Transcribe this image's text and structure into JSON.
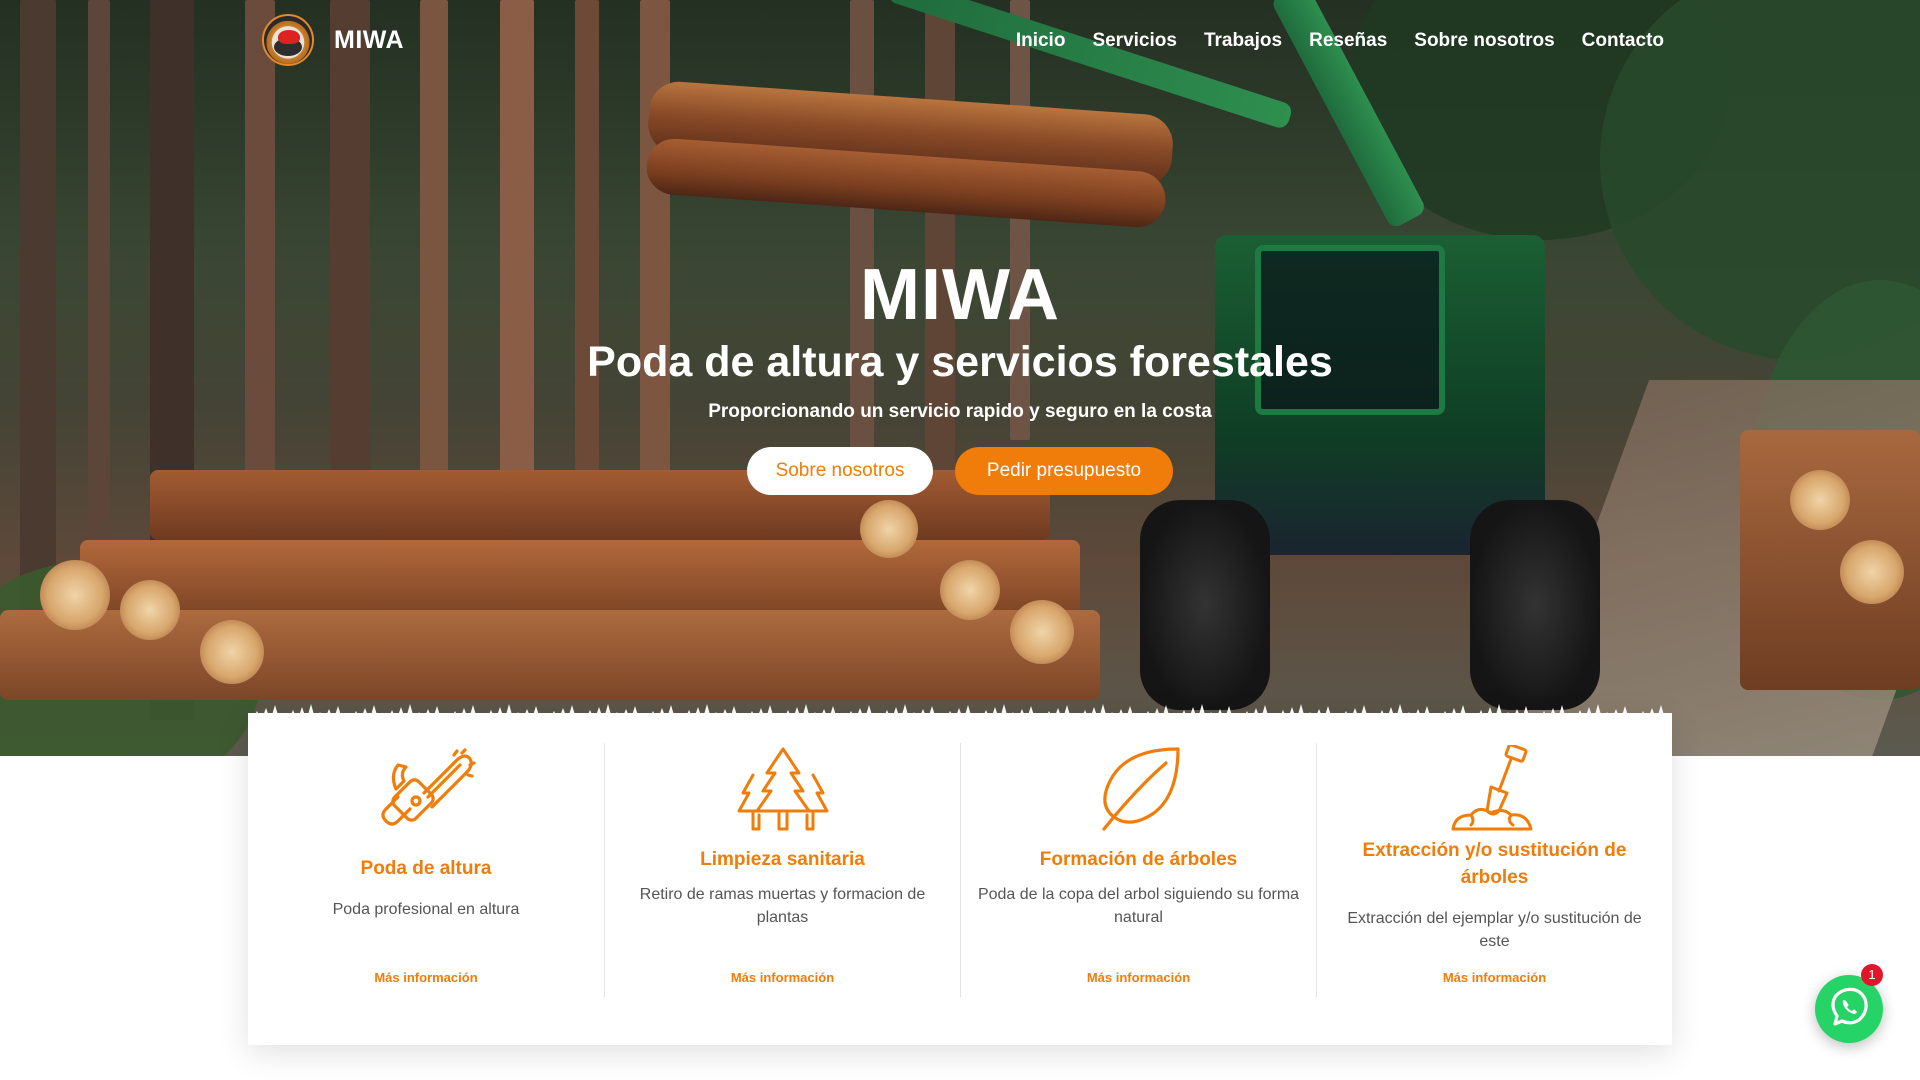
{
  "brand": {
    "name": "MIWA"
  },
  "nav": {
    "items": [
      "Inicio",
      "Servicios",
      "Trabajos",
      "Reseñas",
      "Sobre nosotros",
      "Contacto"
    ]
  },
  "hero": {
    "title": "MIWA",
    "subtitle": "Poda de altura y servicios forestales",
    "tagline": "Proporcionando un servicio rapido y seguro en la costa",
    "btn_about": "Sobre nosotros",
    "btn_quote": "Pedir presupuesto"
  },
  "services": [
    {
      "icon": "chainsaw-icon",
      "title": "Poda de altura",
      "desc": "Poda profesional en altura",
      "link": "Más información"
    },
    {
      "icon": "pine-trees-icon",
      "title": "Limpieza sanitaria",
      "desc": "Retiro de ramas muertas y formacion de plantas",
      "link": "Más información"
    },
    {
      "icon": "leaf-icon",
      "title": "Formación de árboles",
      "desc": "Poda de la copa del arbol siguiendo su forma natural",
      "link": "Más información"
    },
    {
      "icon": "shovel-icon",
      "title": "Extracción y/o sustitución de árboles",
      "desc": "Extracción del ejemplar y/o sustitución de este",
      "link": "Más información"
    }
  ],
  "whatsapp": {
    "badge": "1",
    "icon": "whatsapp-icon"
  },
  "colors": {
    "accent": "#f07c0a",
    "whatsapp": "#25d366",
    "badge": "#e0162b"
  }
}
